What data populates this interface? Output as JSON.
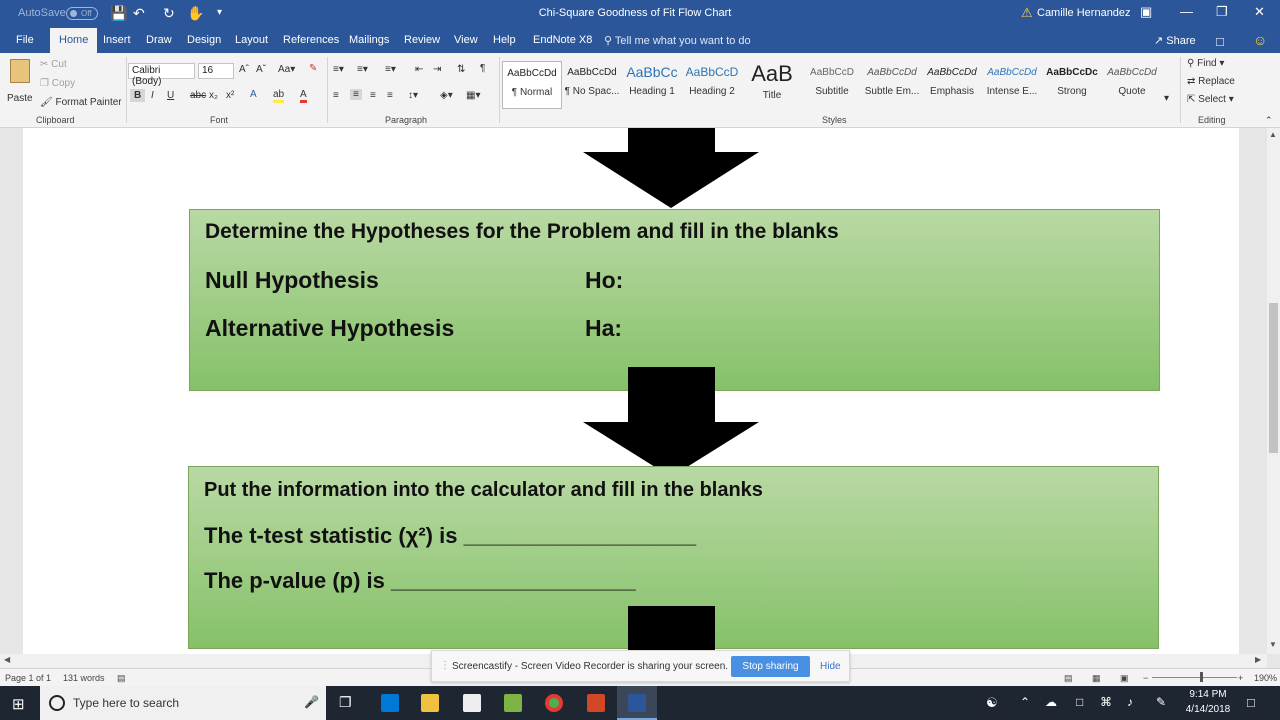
{
  "titlebar": {
    "autosave": "AutoSave",
    "autosave_state": "Off",
    "title": "Chi-Square Goodness of Fit Flow Chart",
    "user": "Camille Hernandez"
  },
  "tabs": [
    "File",
    "Home",
    "Insert",
    "Draw",
    "Design",
    "Layout",
    "References",
    "Mailings",
    "Review",
    "View",
    "Help",
    "EndNote X8"
  ],
  "tell_me": "Tell me what you want to do",
  "share": "Share",
  "clipboard": {
    "paste": "Paste",
    "cut": "Cut",
    "copy": "Copy",
    "format_painter": "Format Painter",
    "label": "Clipboard"
  },
  "font": {
    "name": "Calibri (Body)",
    "size": "16",
    "label": "Font"
  },
  "paragraph": {
    "label": "Paragraph"
  },
  "styles": {
    "label": "Styles",
    "items": [
      {
        "preview": "AaBbCcDd",
        "name": "¶ Normal"
      },
      {
        "preview": "AaBbCcDd",
        "name": "¶ No Spac..."
      },
      {
        "preview": "AaBbCc",
        "name": "Heading 1"
      },
      {
        "preview": "AaBbCcD",
        "name": "Heading 2"
      },
      {
        "preview": "AaB",
        "name": "Title"
      },
      {
        "preview": "AaBbCcD",
        "name": "Subtitle"
      },
      {
        "preview": "AaBbCcDd",
        "name": "Subtle Em..."
      },
      {
        "preview": "AaBbCcDd",
        "name": "Emphasis"
      },
      {
        "preview": "AaBbCcDd",
        "name": "Intense E..."
      },
      {
        "preview": "AaBbCcDc",
        "name": "Strong"
      },
      {
        "preview": "AaBbCcDd",
        "name": "Quote"
      }
    ]
  },
  "editing": {
    "find": "Find",
    "replace": "Replace",
    "select": "Select",
    "label": "Editing"
  },
  "document": {
    "box1": {
      "heading": "Determine the Hypotheses for the Problem and fill in the blanks",
      "null_label": "Null Hypothesis",
      "null_symbol": "Ho:",
      "alt_label": "Alternative Hypothesis",
      "alt_symbol": "Ha:"
    },
    "box2": {
      "heading": "Put the information into the calculator and fill in the blanks",
      "stat_line": "The t-test statistic (χ²) is ___________________",
      "p_line": "The p-value (p) is ____________________"
    }
  },
  "status": {
    "page": "Page 1 of 1",
    "words": "131 words",
    "zoom": "190%"
  },
  "banner": {
    "message": "Screencastify - Screen Video Recorder is sharing your screen.",
    "stop": "Stop sharing",
    "hide": "Hide"
  },
  "taskbar": {
    "search_placeholder": "Type here to search",
    "time": "9:14 PM",
    "date": "4/14/2018"
  }
}
